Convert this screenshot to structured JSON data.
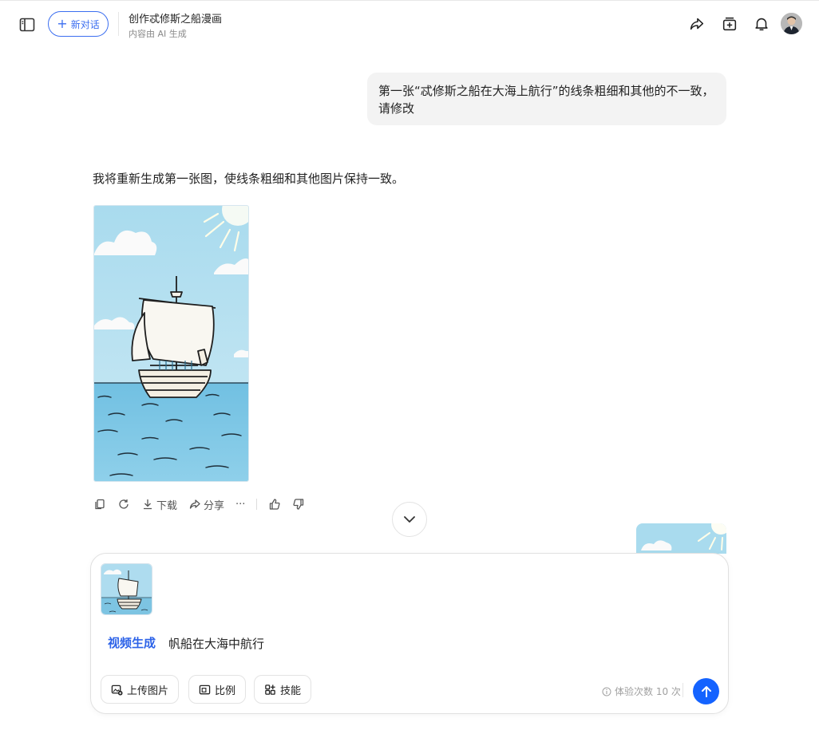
{
  "header": {
    "new_chat_label": "新对话",
    "conversation_title": "创作忒修斯之船漫画",
    "conversation_subtitle": "内容由 AI 生成"
  },
  "messages": {
    "user_text": "第一张“忒修斯之船在大海上航行”的线条粗细和其他的不一致，请修改",
    "assistant_text": "我将重新生成第一张图，使线条粗细和其他图片保持一致。"
  },
  "actions": {
    "download_label": "下载",
    "share_label": "分享",
    "more_label": "···"
  },
  "composer": {
    "skill_tag": "视频生成",
    "prompt": "帆船在大海中航行",
    "upload_label": "上传图片",
    "ratio_label": "比例",
    "skills_label": "技能",
    "quota_text": "体验次数 10 次"
  },
  "colors": {
    "accent": "#1463ff",
    "brand_blue": "#3b6ef0",
    "sky": "#a9d9ec",
    "sea": "#7ec6e3"
  },
  "icons": [
    "sidebar-icon",
    "plus-icon",
    "share-icon",
    "add-to-collection-icon",
    "bell-icon",
    "copy-icon",
    "regenerate-icon",
    "download-icon",
    "thumbs-up-icon",
    "thumbs-down-icon",
    "chevron-down-icon",
    "image-upload-icon",
    "ratio-icon",
    "skills-icon",
    "info-icon",
    "arrow-up-icon"
  ]
}
